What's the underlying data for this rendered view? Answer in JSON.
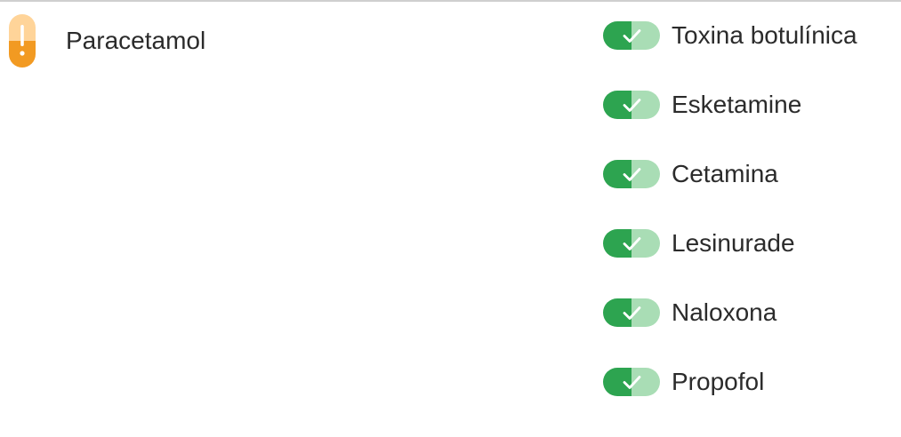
{
  "primary_drug": {
    "name": "Paracetamol",
    "icon": "warning-pill-icon",
    "icon_colors": {
      "top": "#FFD499",
      "bottom": "#F29A22",
      "mark": "#ffffff"
    }
  },
  "interactions": [
    {
      "name": "Toxina botulínica",
      "status_icon": "check-pill-icon"
    },
    {
      "name": "Esketamine",
      "status_icon": "check-pill-icon"
    },
    {
      "name": "Cetamina",
      "status_icon": "check-pill-icon"
    },
    {
      "name": "Lesinurade",
      "status_icon": "check-pill-icon"
    },
    {
      "name": "Naloxona",
      "status_icon": "check-pill-icon"
    },
    {
      "name": "Propofol",
      "status_icon": "check-pill-icon"
    }
  ],
  "colors": {
    "ok_dark": "#2DA450",
    "ok_light": "#A9DDB5",
    "text": "#2B2B2B",
    "rule": "#CFCFCF"
  }
}
